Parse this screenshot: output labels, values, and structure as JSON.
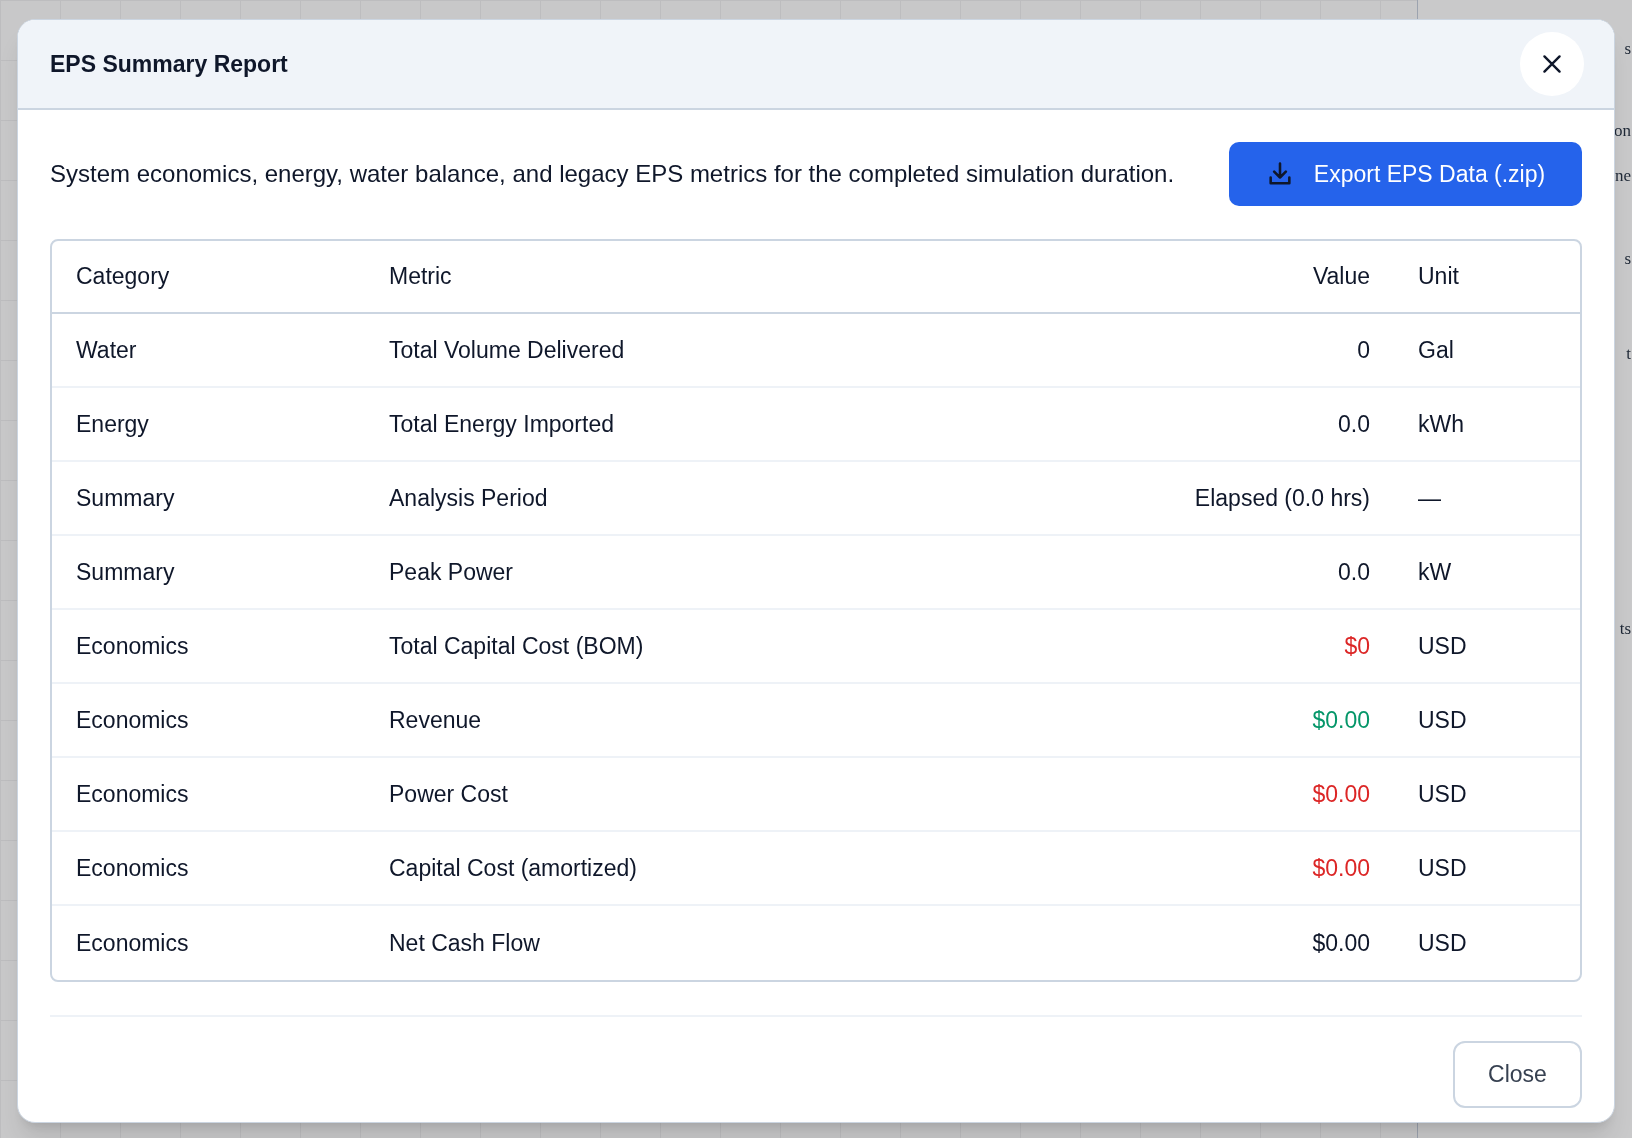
{
  "background_fragments": [
    {
      "text": "s"
    },
    {
      "text": "on"
    },
    {
      "text": "ne"
    },
    {
      "text": "s"
    },
    {
      "text": "t"
    },
    {
      "text": "ts"
    }
  ],
  "dialog": {
    "title": "EPS Summary Report",
    "description": "System economics, energy, water balance, and legacy EPS metrics for the completed simulation duration.",
    "export_button": "Export EPS Data (.zip)",
    "close_button": "Close"
  },
  "table": {
    "columns": [
      "Category",
      "Metric",
      "Value",
      "Unit"
    ],
    "rows": [
      {
        "category": "Water",
        "metric": "Total Volume Delivered",
        "value": "0",
        "unit": "Gal",
        "color": "#0f172a"
      },
      {
        "category": "Energy",
        "metric": "Total Energy Imported",
        "value": "0.0",
        "unit": "kWh",
        "color": "#0f172a"
      },
      {
        "category": "Summary",
        "metric": "Analysis Period",
        "value": "Elapsed (0.0 hrs)",
        "unit": "—",
        "color": "#0f172a"
      },
      {
        "category": "Summary",
        "metric": "Peak Power",
        "value": "0.0",
        "unit": "kW",
        "color": "#0f172a"
      },
      {
        "category": "Economics",
        "metric": "Total Capital Cost (BOM)",
        "value": "$0",
        "unit": "USD",
        "color": "#dc2626"
      },
      {
        "category": "Economics",
        "metric": "Revenue",
        "value": "$0.00",
        "unit": "USD",
        "color": "#059669"
      },
      {
        "category": "Economics",
        "metric": "Power Cost",
        "value": "$0.00",
        "unit": "USD",
        "color": "#dc2626"
      },
      {
        "category": "Economics",
        "metric": "Capital Cost (amortized)",
        "value": "$0.00",
        "unit": "USD",
        "color": "#dc2626"
      },
      {
        "category": "Economics",
        "metric": "Net Cash Flow",
        "value": "$0.00",
        "unit": "USD",
        "color": "#0f172a"
      }
    ]
  }
}
